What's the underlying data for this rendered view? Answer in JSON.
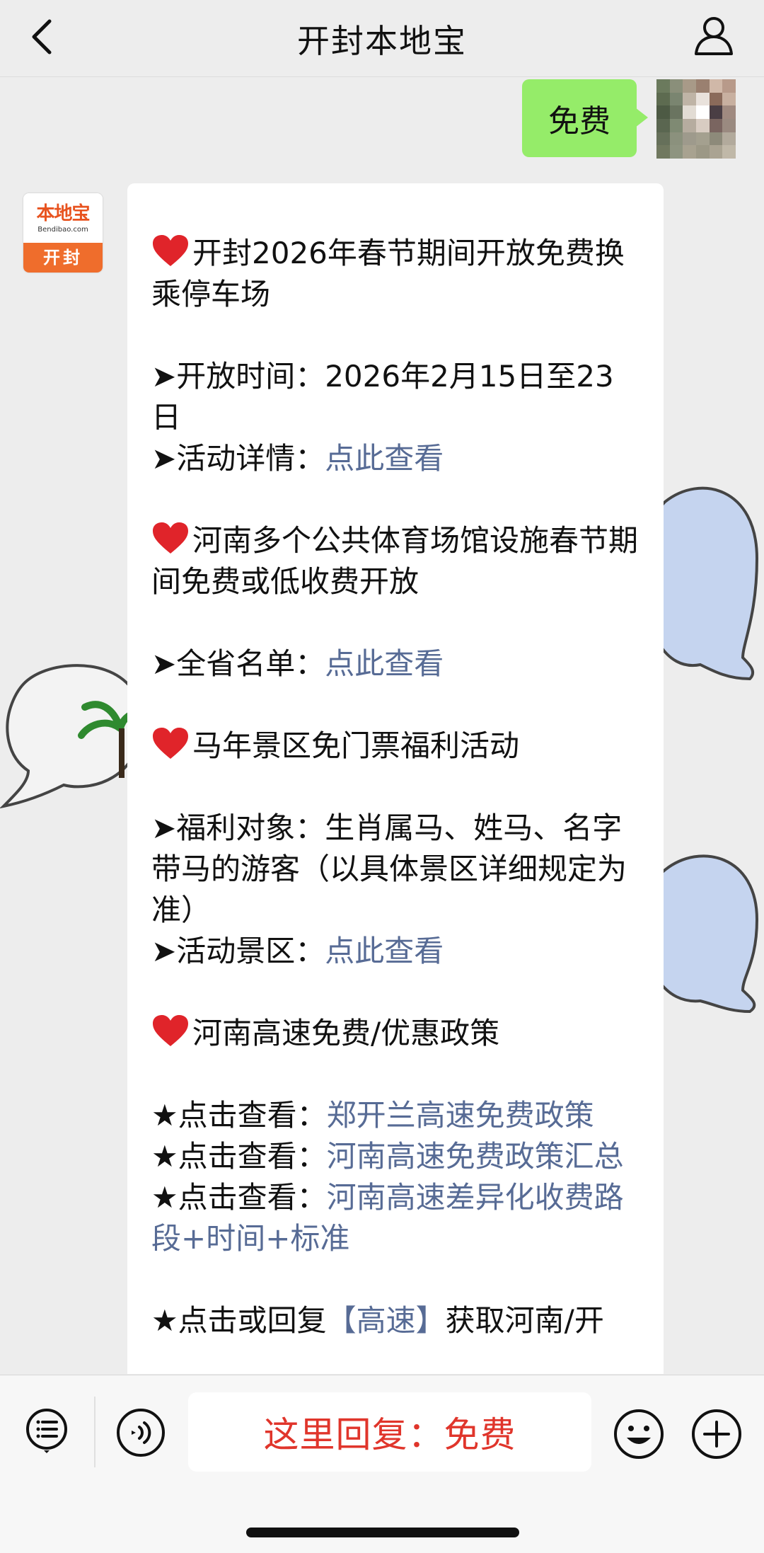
{
  "header": {
    "title": "开封本地宝"
  },
  "user_message": {
    "text": "免费"
  },
  "account_avatar": {
    "brand": "本地宝",
    "domain": "Bendibao.com",
    "city": "开封"
  },
  "message": {
    "block1_title": "开封2026年春节期间开放免费换乘停车场",
    "block1_time_label": "➤开放时间：",
    "block1_time_value": "2026年2月15日至23日",
    "block1_detail_label": "➤活动详情：",
    "block1_detail_link": "点此查看",
    "block2_title": "河南多个公共体育场馆设施春节期间免费或低收费开放",
    "block2_list_label": "➤全省名单：",
    "block2_list_link": "点此查看",
    "block3_title": "马年景区免门票福利活动",
    "block3_target_label": "➤福利对象：",
    "block3_target_value": "生肖属马、姓马、名字带马的游客（以具体景区详细规定为准）",
    "block3_scenic_label": "➤活动景区：",
    "block3_scenic_link": "点此查看",
    "block4_title": "河南高速免费/优惠政策",
    "star1_label": "★点击查看：",
    "star1_link": "郑开兰高速免费政策",
    "star2_label": "★点击查看：",
    "star2_link": "河南高速免费政策汇总",
    "star3_label": "★点击查看：",
    "star3_link": "河南高速差异化收费路段+时间+标准",
    "cut_prefix": "★点击或回复",
    "cut_keyword": "【高速】",
    "cut_suffix": "获取河南/开"
  },
  "input_bar": {
    "placeholder_text": "这里回复：免费"
  },
  "colors": {
    "link": "#576b95",
    "user_bubble": "#95ec69",
    "reply_red": "#e0352b",
    "brand_orange": "#ef6d2c"
  },
  "icons": [
    "back-chevron-icon",
    "person-icon",
    "menu-list-icon",
    "voice-icon",
    "emoji-icon",
    "plus-icon",
    "heart-icon"
  ]
}
